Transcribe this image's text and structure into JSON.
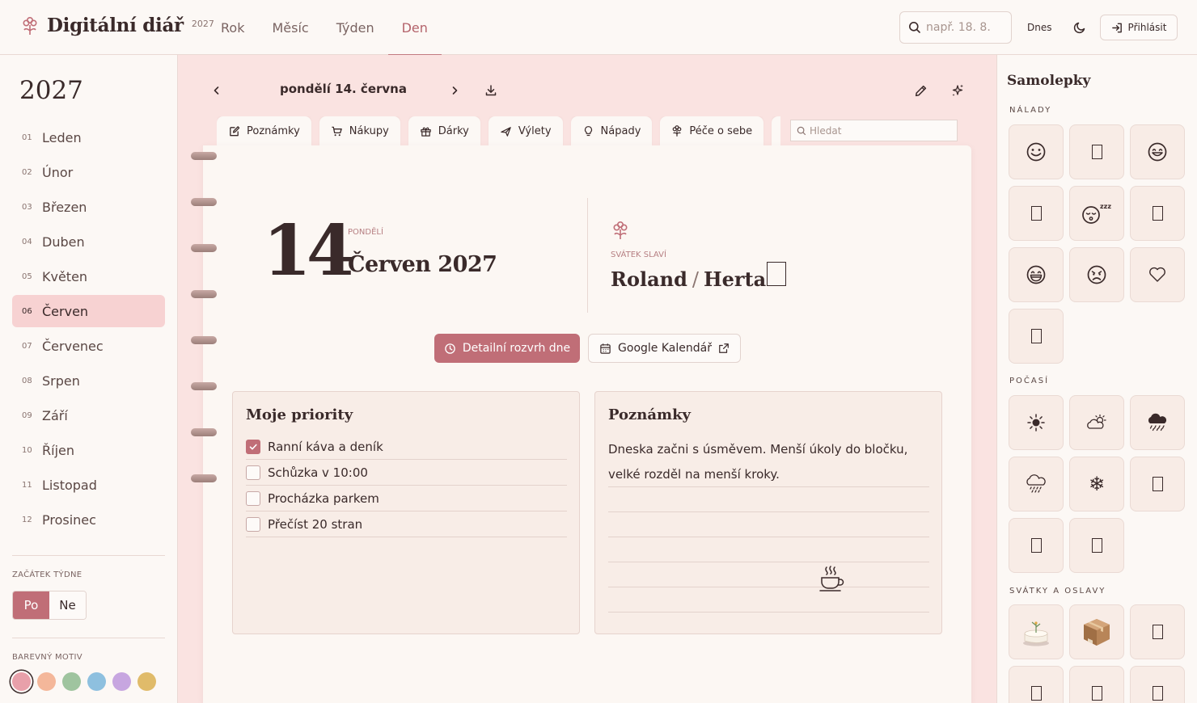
{
  "app": {
    "title": "Digitální diář",
    "year_badge": "2027"
  },
  "view_tabs": [
    {
      "label": "Rok"
    },
    {
      "label": "Měsíc"
    },
    {
      "label": "Týden"
    },
    {
      "label": "Den",
      "active": true
    }
  ],
  "top_search": {
    "placeholder": "např. 18. 8.",
    "value": ""
  },
  "top_actions": {
    "today_label": "Dnes",
    "login_label": "Přihlásit"
  },
  "sidebar": {
    "year": "2027",
    "months": [
      {
        "num": "01",
        "name": "Leden"
      },
      {
        "num": "02",
        "name": "Únor"
      },
      {
        "num": "03",
        "name": "Březen"
      },
      {
        "num": "04",
        "name": "Duben"
      },
      {
        "num": "05",
        "name": "Květen"
      },
      {
        "num": "06",
        "name": "Červen",
        "active": true
      },
      {
        "num": "07",
        "name": "Červenec"
      },
      {
        "num": "08",
        "name": "Srpen"
      },
      {
        "num": "09",
        "name": "Září"
      },
      {
        "num": "10",
        "name": "Říjen"
      },
      {
        "num": "11",
        "name": "Listopad"
      },
      {
        "num": "12",
        "name": "Prosinec"
      }
    ],
    "week_start_label": "ZAČÁTEK TÝDNE",
    "week_start_options": [
      {
        "label": "Po",
        "active": true
      },
      {
        "label": "Ne"
      }
    ],
    "theme_label": "BAREVNÝ MOTIV",
    "theme_colors": [
      "#e8a0aa",
      "#f4b79a",
      "#9fc49f",
      "#8ec0df",
      "#c7a6e0",
      "#e0bb6a"
    ],
    "theme_selected": 0
  },
  "day_nav": {
    "title": "pondělí 14. června"
  },
  "category_tabs": [
    {
      "label": "Poznámky",
      "icon": "note-edit-icon"
    },
    {
      "label": "Nákupy",
      "icon": "cart-icon"
    },
    {
      "label": "Dárky",
      "icon": "gift-icon"
    },
    {
      "label": "Výlety",
      "icon": "plane-icon"
    },
    {
      "label": "Nápady",
      "icon": "lightbulb-icon"
    },
    {
      "label": "Péče o sebe",
      "icon": "flower-icon"
    },
    {
      "label": "",
      "icon": "partial-icon"
    }
  ],
  "tab_search": {
    "placeholder": "Hledat",
    "value": ""
  },
  "day": {
    "number": "14",
    "weekday": "PONDĚLÍ",
    "month_year": "Červen 2027",
    "nameday_label": "SVÁTEK SLAVÍ",
    "names": [
      "Roland",
      "Herta"
    ]
  },
  "buttons": {
    "schedule": "Detailní rozvrh dne",
    "google": "Google Kalendář"
  },
  "priorities": {
    "title": "Moje priority",
    "items": [
      {
        "text": "Ranní káva a deník",
        "done": true
      },
      {
        "text": "Schůzka v 10:00",
        "done": false
      },
      {
        "text": "Procházka parkem",
        "done": false
      },
      {
        "text": "Přečíst 20 stran",
        "done": false
      }
    ]
  },
  "notes": {
    "title": "Poznámky",
    "text": "Dneska začni s úsměvem. Menší úkoly do bločku, velké rozděl na menší kroky."
  },
  "stickers": {
    "title": "Samolepky",
    "sections": [
      {
        "label": "NÁLADY",
        "items": [
          "☺",
          "",
          "☺",
          "",
          "sleepy-face",
          "",
          "☻",
          "☹",
          "♡",
          ""
        ]
      },
      {
        "label": "POČASÍ",
        "items": [
          "☀",
          "sun-cloud",
          "rain-cloud",
          "snow-cloud",
          "❄",
          "",
          "",
          ""
        ]
      },
      {
        "label": "SVÁTKY A OSLAVY",
        "items": [
          "cake",
          "gift-box",
          "",
          "",
          "",
          ""
        ]
      }
    ]
  },
  "colors": {
    "accent": "#c06e77",
    "accent_light": "#f7d2d2",
    "main_bg": "#fae3e1",
    "page_bg": "#fcf7f3",
    "text": "#3a2a2a"
  }
}
